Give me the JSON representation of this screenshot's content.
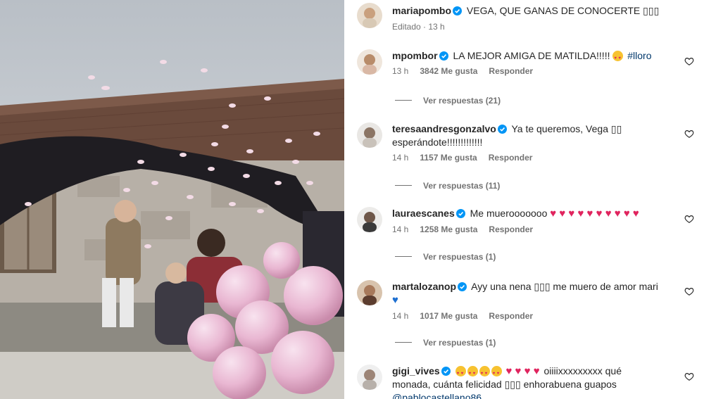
{
  "post": {
    "author": "mariapombo",
    "caption": "VEGA, QUE GANAS DE CONOCERTE",
    "caption_glyphs": "▯▯▯",
    "edited": "Editado",
    "time": "13 h"
  },
  "comments": [
    {
      "user": "mpombor",
      "text": "LA MEJOR AMIGA DE MATILDA!!!!!",
      "hashtag": "#lloro",
      "time": "13 h",
      "likes": "3842 Me gusta",
      "reply": "Responder",
      "view_replies": "Ver respuestas (21)"
    },
    {
      "user": "teresaandresgonzalvo",
      "text": "Ya te queremos, Vega",
      "glyphs": "▯▯",
      "text2": "esperándote!!!!!!!!!!!!!",
      "time": "14 h",
      "likes": "1157 Me gusta",
      "reply": "Responder",
      "view_replies": "Ver respuestas (11)"
    },
    {
      "user": "lauraescanes",
      "text": "Me muerooooooo",
      "hearts": "♥ ♥ ♥ ♥ ♥ ♥ ♥ ♥ ♥ ♥",
      "time": "14 h",
      "likes": "1258 Me gusta",
      "reply": "Responder",
      "view_replies": "Ver respuestas (1)"
    },
    {
      "user": "martalozanop",
      "text": "Ayy una nena",
      "glyphs": "▯▯▯",
      "text_after": "me muero de amor mari",
      "blue_heart": "♥",
      "time": "14 h",
      "likes": "1017 Me gusta",
      "reply": "Responder",
      "view_replies": "Ver respuestas (1)"
    },
    {
      "user": "gigi_vives",
      "hearts": "♥ ♥ ♥ ♥",
      "text": "oiiiixxxxxxxxx qué",
      "text2": "monada, cuánta felicidad",
      "glyphs": "▯▯▯",
      "text3": "enhorabuena guapos",
      "mention": "@pablocastellano86"
    }
  ],
  "colors": {
    "link": "#00376b",
    "muted": "#737373",
    "verified": "#0095f6",
    "heart_red": "#e0245e"
  },
  "icons": [
    "verified-badge-icon",
    "heart-outline-icon",
    "face-with-heart-eyes-emoji"
  ]
}
